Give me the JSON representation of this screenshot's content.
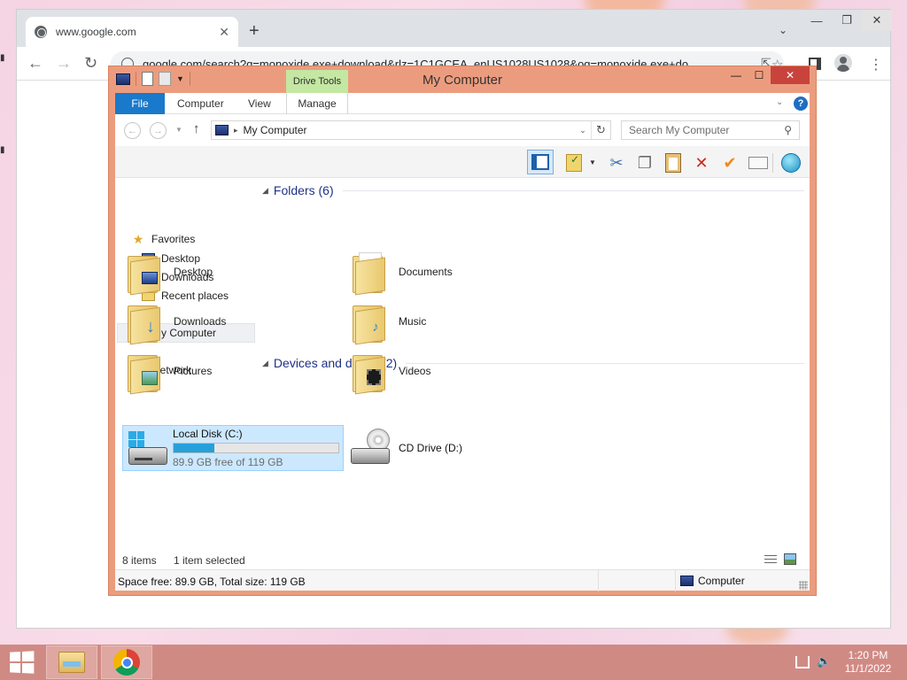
{
  "browser": {
    "tab_title": "www.google.com",
    "tab_close": "✕",
    "new_tab": "+",
    "url": "google.com/search?q=monoxide.exe+download&rlz=1C1GCEA_enUS1028US1028&oq=monoxide.exe+do",
    "icons": [
      "globe-icon",
      "back-icon",
      "forward-icon",
      "reload-icon",
      "info-icon",
      "share-icon",
      "star-icon",
      "side-panel-icon",
      "profile-icon",
      "menu-icon"
    ]
  },
  "explorer": {
    "title": "My Computer",
    "contextual_tab": "Drive Tools",
    "ribbon_tabs": {
      "file": "File",
      "computer": "Computer",
      "view": "View",
      "manage": "Manage"
    },
    "help": "?",
    "address": "My Computer",
    "search_placeholder": "Search My Computer",
    "nav_pane": {
      "favorites": "Favorites",
      "desktop": "Desktop",
      "downloads": "Downloads",
      "recent": "Recent places",
      "my_computer": "My Computer",
      "network": "Network"
    },
    "folders_header": "Folders (6)",
    "folders": {
      "desktop": "Desktop",
      "documents": "Documents",
      "downloads": "Downloads",
      "music": "Music",
      "pictures": "Pictures",
      "videos": "Videos"
    },
    "devices_header": "Devices and drives (2)",
    "drive_c": {
      "name": "Local Disk (C:)",
      "free_text": "89.9 GB free of 119 GB",
      "used_fraction": 0.245
    },
    "drive_d": {
      "name": "CD Drive (D:)"
    },
    "status": {
      "count": "8 items",
      "selected": "1 item selected"
    },
    "infobar": {
      "text": "Space free: 89.9 GB, Total size: 119 GB",
      "location": "Computer"
    },
    "colors": {
      "frame": "#ec9c7e",
      "file_tab": "#1979ca",
      "drive_tools": "#c4e7a4",
      "selection": "#cce8ff",
      "bar_fill": "#26a0da",
      "close": "#c9433d"
    }
  },
  "taskbar": {
    "time": "1:20 PM",
    "date": "11/1/2022",
    "colors": {
      "bar": "#d08a84"
    }
  }
}
